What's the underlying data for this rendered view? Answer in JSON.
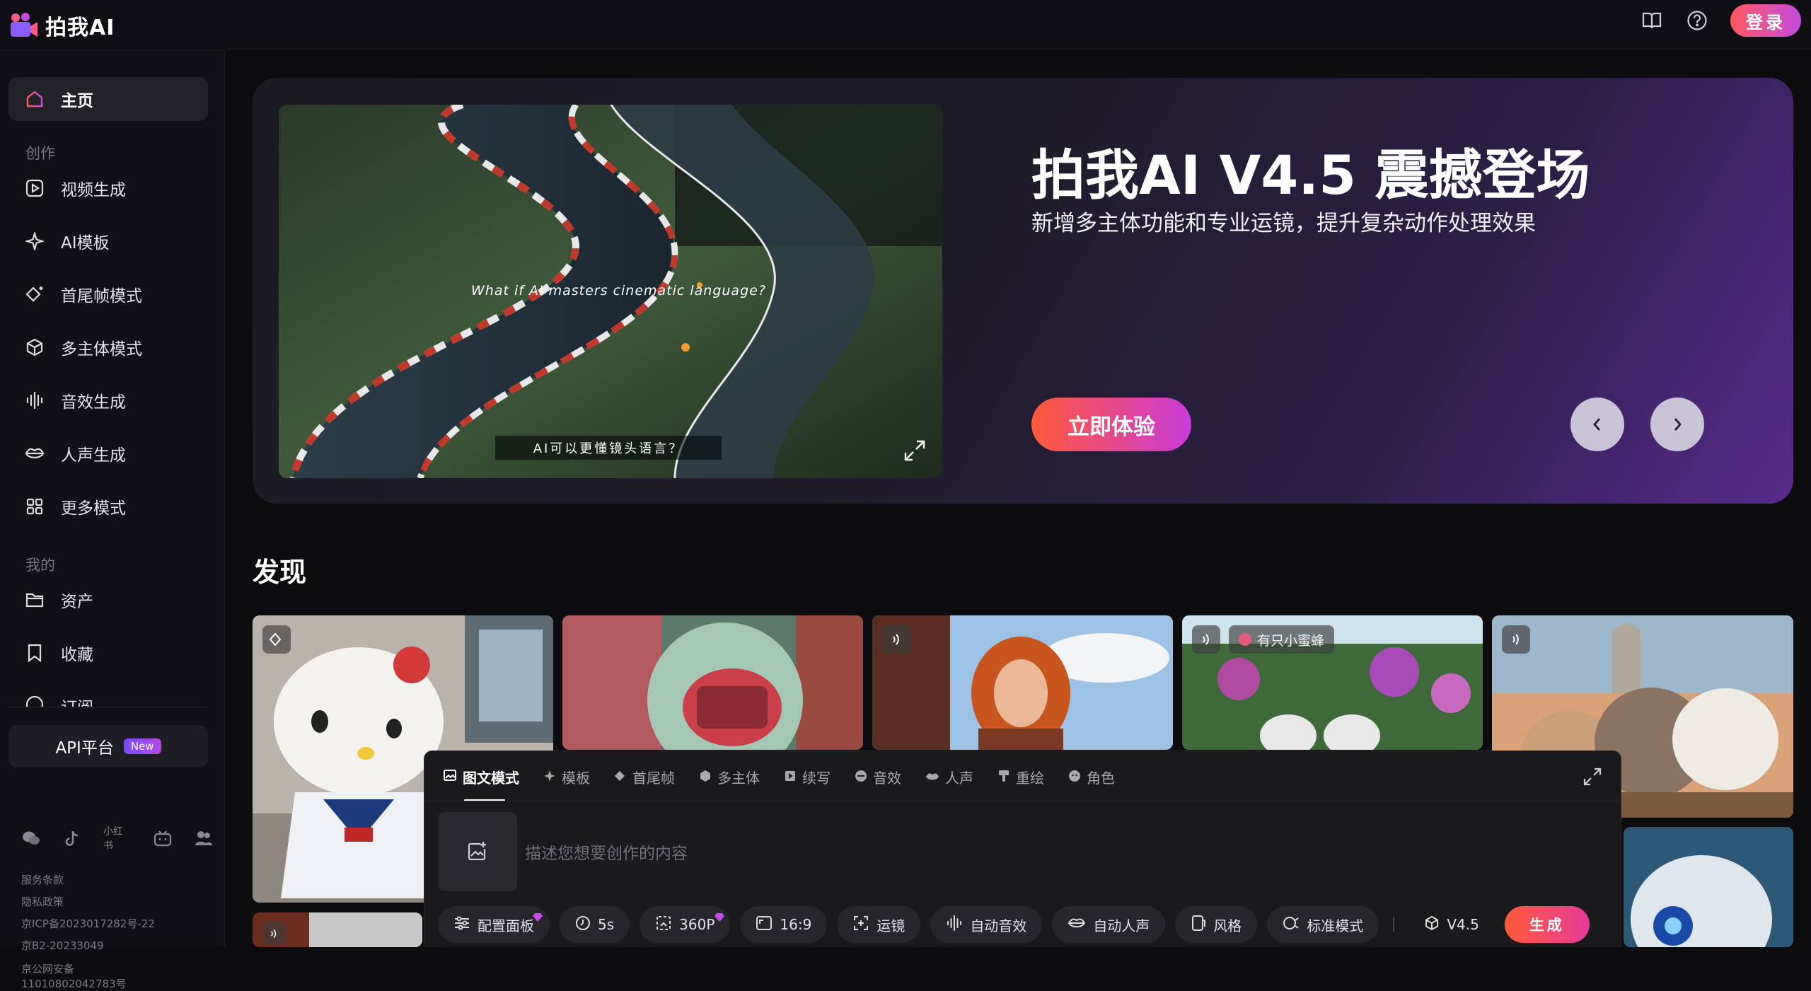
{
  "app": {
    "name": "拍我AI"
  },
  "header": {
    "login_label": "登录"
  },
  "sidebar": {
    "home_label": "主页",
    "section_create": "创作",
    "create_items": [
      {
        "label": "视频生成",
        "icon": "video-play-icon"
      },
      {
        "label": "AI模板",
        "icon": "sparkle-icon"
      },
      {
        "label": "首尾帧模式",
        "icon": "diamond-icon"
      },
      {
        "label": "多主体模式",
        "icon": "cube-icon"
      },
      {
        "label": "音效生成",
        "icon": "waveform-icon"
      },
      {
        "label": "人声生成",
        "icon": "lips-icon"
      },
      {
        "label": "更多模式",
        "icon": "grid-icon"
      }
    ],
    "section_mine": "我的",
    "mine_items": [
      {
        "label": "资产",
        "icon": "folder-icon"
      },
      {
        "label": "收藏",
        "icon": "bookmark-icon"
      },
      {
        "label": "订阅",
        "icon": "subscribe-icon"
      }
    ],
    "api_label": "API平台",
    "api_badge": "New",
    "social": [
      "wechat-icon",
      "tiktok-icon",
      "xiaohongshu-icon",
      "bilibili-icon",
      "community-icon"
    ],
    "social_text": "小红书",
    "footer": [
      "服务条款",
      "隐私政策",
      "京ICP备2023017282号-22",
      "京B2-20233049",
      "京公网安备",
      "11010802042783号"
    ]
  },
  "hero": {
    "title": "拍我AI V4.5 震撼登场",
    "subtitle": "新增多主体功能和专业运镜，提升复杂动作处理效果",
    "cta_label": "立即体验",
    "video_caption_en": "What if AI masters cinematic language?",
    "video_caption_cn": "AI可以更懂镜头语言？"
  },
  "discover": {
    "title": "发现",
    "card_tag": "有只小蜜蜂"
  },
  "composer": {
    "tabs": [
      {
        "label": "图文模式",
        "icon": "image-text-icon"
      },
      {
        "label": "模板",
        "icon": "sparkle-icon"
      },
      {
        "label": "首尾帧",
        "icon": "diamond-icon"
      },
      {
        "label": "多主体",
        "icon": "cube-icon"
      },
      {
        "label": "续写",
        "icon": "continue-icon"
      },
      {
        "label": "音效",
        "icon": "sound-icon"
      },
      {
        "label": "人声",
        "icon": "lips-icon"
      },
      {
        "label": "重绘",
        "icon": "brush-icon"
      },
      {
        "label": "角色",
        "icon": "character-icon"
      }
    ],
    "placeholder": "描述您想要创作的内容",
    "options": [
      {
        "label": "配置面板",
        "icon": "sliders-icon"
      },
      {
        "label": "5s",
        "icon": "clock-icon"
      },
      {
        "label": "360P",
        "icon": "resolution-icon"
      },
      {
        "label": "16:9",
        "icon": "aspect-ratio-icon"
      },
      {
        "label": "运镜",
        "icon": "camera-move-icon"
      },
      {
        "label": "自动音效",
        "icon": "waveform-icon"
      },
      {
        "label": "自动人声",
        "icon": "lips-icon"
      },
      {
        "label": "风格",
        "icon": "style-icon"
      },
      {
        "label": "标准模式",
        "icon": "mode-icon"
      }
    ],
    "version": "V4.5",
    "generate_label": "生成"
  },
  "colors": {
    "accent_start": "#ff5a3a",
    "accent_end": "#c83ad8",
    "brand_purple": "#7a4cff"
  }
}
